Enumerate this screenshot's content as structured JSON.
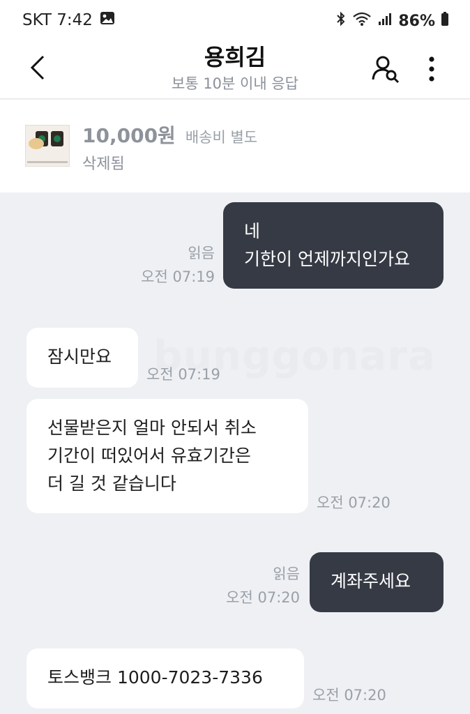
{
  "status_bar": {
    "carrier_time": "SKT 7:42",
    "battery": "86%",
    "icons": [
      "image-icon",
      "bluetooth-icon",
      "wifi-icon",
      "signal-icon",
      "battery-icon"
    ]
  },
  "header": {
    "title": "용희김",
    "subtitle": "보통 10분 이내 응답"
  },
  "product": {
    "price": "10,000원",
    "shipping": "배송비 별도",
    "status": "삭제됨"
  },
  "watermark": "bunggonara",
  "messages": [
    {
      "side": "mine",
      "lines": [
        "네",
        "기한이 언제까지인가요"
      ],
      "read": "읽음",
      "time": "오전 07:19"
    },
    {
      "side": "theirs",
      "lines": [
        "잠시만요"
      ],
      "time": "오전 07:19"
    },
    {
      "side": "theirs",
      "lines": [
        "선물받은지 얼마 안되서 취소",
        "기간이 떠있어서 유효기간은",
        "더 길 것 같습니다"
      ],
      "time": "오전 07:20"
    },
    {
      "side": "mine",
      "lines": [
        "계좌주세요"
      ],
      "read": "읽음",
      "time": "오전 07:20"
    },
    {
      "side": "theirs",
      "lines": [
        "토스뱅크 1000-7023-7336"
      ],
      "time": "오전 07:20"
    }
  ],
  "colors": {
    "my_bubble": "#363a44",
    "their_bubble": "#ffffff",
    "chat_background": "#eef0f4"
  }
}
